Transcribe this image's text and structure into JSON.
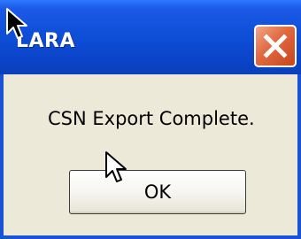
{
  "window": {
    "title": "LARA",
    "close_icon": "close-x-icon"
  },
  "dialog": {
    "message": "CSN Export Complete.",
    "ok_label": "OK"
  },
  "cursors": [
    "arrow-cursor-icon",
    "arrow-cursor-icon"
  ],
  "colors": {
    "titlebar": "#0f4fd8",
    "close_button": "#e0683f",
    "dialog_bg": "#ece9d8"
  }
}
